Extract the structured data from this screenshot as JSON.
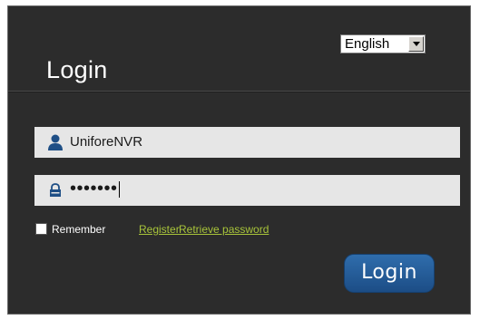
{
  "header": {
    "title": "Login",
    "language": {
      "selected": "English"
    }
  },
  "form": {
    "username": {
      "value": "UniforeNVR",
      "icon": "user-icon"
    },
    "password": {
      "masked_value": "•••••••",
      "icon": "lock-icon"
    },
    "remember_label": "Remember",
    "register_link": "Register",
    "retrieve_link": "Retrieve password",
    "login_button": "Login"
  },
  "colors": {
    "panel_bg": "#2c2c2c",
    "field_bg": "#e6e6e6",
    "link": "#a8c43a",
    "button": "#1f548f",
    "icon": "#1f4f86"
  }
}
